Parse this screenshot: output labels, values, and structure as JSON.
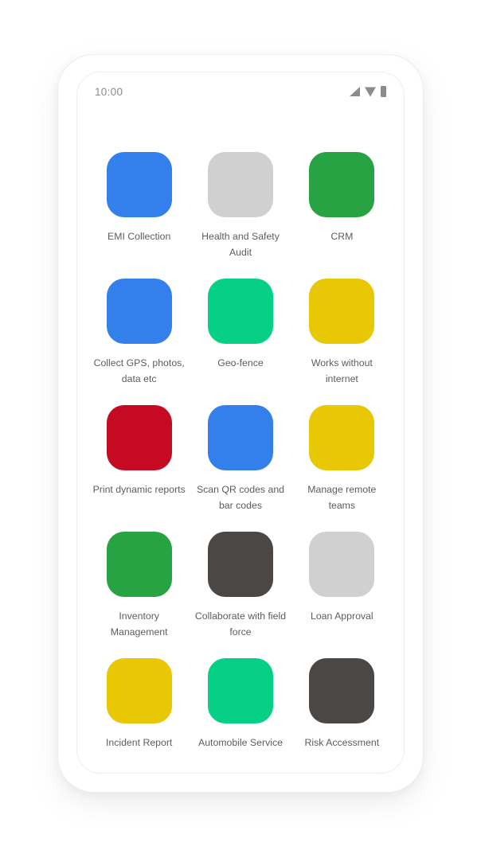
{
  "device": {
    "status_bar": {
      "clock": "10:00",
      "icons": [
        {
          "name": "signal-icon",
          "glyph": "signal"
        },
        {
          "name": "wifi-icon",
          "glyph": "wifi"
        },
        {
          "name": "battery-icon",
          "glyph": "battery"
        }
      ],
      "icon_color": "#8c8c8c"
    }
  },
  "palette": {
    "blue": "#3380EC",
    "light_gray": "#D0D0D0",
    "green": "#27A343",
    "teal": "#06D086",
    "gold": "#E8C705",
    "red": "#C50A21",
    "dark_gray": "#4A4745",
    "label_text": "#5d5d5d",
    "page_background": "#ffffff"
  },
  "app_grid": {
    "columns": 3,
    "rows": 5,
    "tiles": [
      {
        "label": "EMI Collection",
        "color": "#3380EC",
        "icon": "emi-collection-icon"
      },
      {
        "label": "Health and Safety Audit",
        "color": "#D0D0D0",
        "icon": "health-safety-audit-icon"
      },
      {
        "label": "CRM",
        "color": "#27A343",
        "icon": "crm-icon"
      },
      {
        "label": "Collect GPS, photos, data etc",
        "color": "#3380EC",
        "icon": "collect-gps-icon"
      },
      {
        "label": "Geo-fence",
        "color": "#06D086",
        "icon": "geo-fence-icon"
      },
      {
        "label": "Works without internet",
        "color": "#E8C705",
        "icon": "works-offline-icon"
      },
      {
        "label": "Print dynamic reports",
        "color": "#C50A21",
        "icon": "print-reports-icon"
      },
      {
        "label": "Scan QR codes and bar codes",
        "color": "#3380EC",
        "icon": "scan-qr-icon"
      },
      {
        "label": "Manage remote teams",
        "color": "#E8C705",
        "icon": "manage-teams-icon"
      },
      {
        "label": "Inventory Management",
        "color": "#27A343",
        "icon": "inventory-management-icon"
      },
      {
        "label": "Collaborate with field force",
        "color": "#4A4745",
        "icon": "collaborate-field-force-icon"
      },
      {
        "label": "Loan Approval",
        "color": "#D0D0D0",
        "icon": "loan-approval-icon"
      },
      {
        "label": "Incident Report",
        "color": "#E8C705",
        "icon": "incident-report-icon"
      },
      {
        "label": "Automobile Service",
        "color": "#06D086",
        "icon": "automobile-service-icon"
      },
      {
        "label": "Risk Accessment",
        "color": "#4A4745",
        "icon": "risk-assessment-icon"
      }
    ]
  }
}
